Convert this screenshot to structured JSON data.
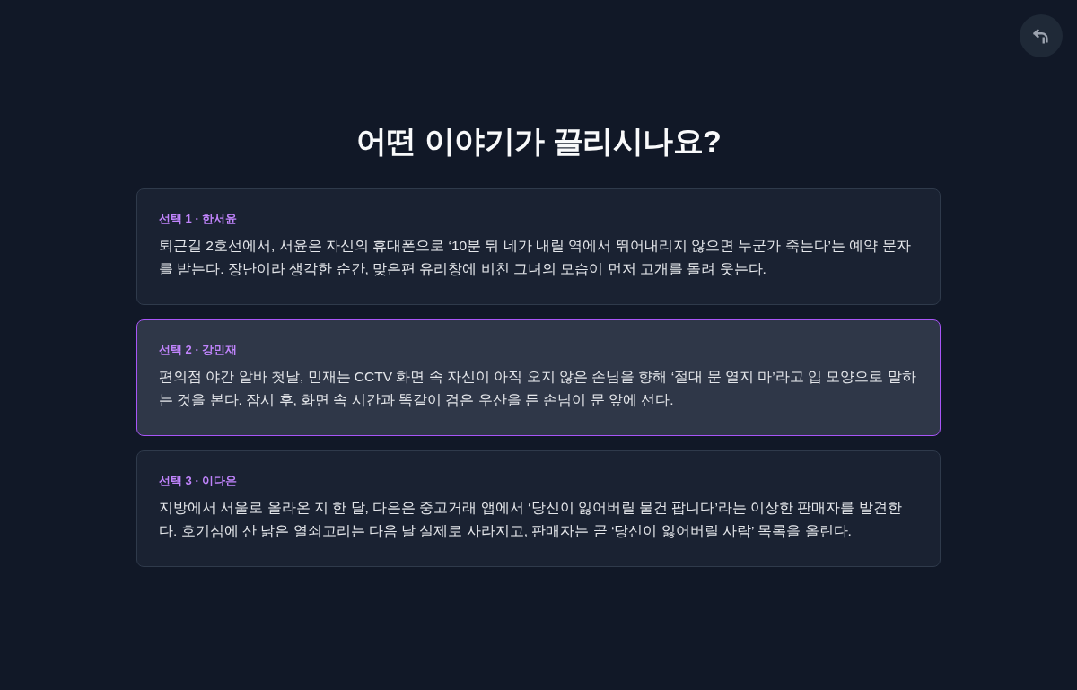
{
  "title": "어떤 이야기가 끌리시나요?",
  "choices": [
    {
      "label": "선택 1 · 한서윤",
      "text": "퇴근길 2호선에서, 서윤은 자신의 휴대폰으로 ‘10분 뒤 네가 내릴 역에서 뛰어내리지 않으면 누군가 죽는다’는 예약 문자를 받는다. 장난이라 생각한 순간, 맞은편 유리창에 비친 그녀의 모습이 먼저 고개를 돌려 웃는다.",
      "selected": false
    },
    {
      "label": "선택 2 · 강민재",
      "text": "편의점 야간 알바 첫날, 민재는 CCTV 화면 속 자신이 아직 오지 않은 손님을 향해 ‘절대 문 열지 마’라고 입 모양으로 말하는 것을 본다. 잠시 후, 화면 속 시간과 똑같이 검은 우산을 든 손님이 문 앞에 선다.",
      "selected": true
    },
    {
      "label": "선택 3 · 이다은",
      "text": "지방에서 서울로 올라온 지 한 달, 다은은 중고거래 앱에서 ‘당신이 잃어버릴 물건 팝니다’라는 이상한 판매자를 발견한다. 호기심에 산 낡은 열쇠고리는 다음 날 실제로 사라지고, 판매자는 곧 ‘당신이 잃어버릴 사람’ 목록을 올린다.",
      "selected": false
    }
  ]
}
